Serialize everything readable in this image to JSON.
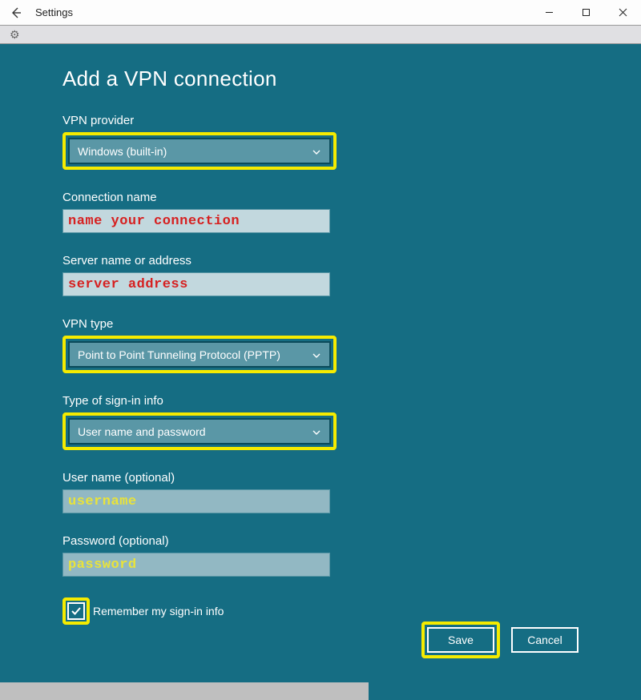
{
  "window": {
    "title": "Settings"
  },
  "page": {
    "title": "Add a VPN connection"
  },
  "fields": {
    "provider": {
      "label": "VPN provider",
      "value": "Windows (built-in)"
    },
    "connection_name": {
      "label": "Connection name",
      "annotation": "name your connection"
    },
    "server": {
      "label": "Server name or address",
      "annotation": "server address"
    },
    "vpn_type": {
      "label": "VPN type",
      "value": "Point to Point Tunneling Protocol (PPTP)"
    },
    "signin_type": {
      "label": "Type of sign-in info",
      "value": "User name and password"
    },
    "username": {
      "label": "User name (optional)",
      "annotation": "username"
    },
    "password": {
      "label": "Password (optional)",
      "annotation": "password"
    },
    "remember": {
      "label": "Remember my sign-in info",
      "checked": true
    }
  },
  "buttons": {
    "save": "Save",
    "cancel": "Cancel"
  }
}
